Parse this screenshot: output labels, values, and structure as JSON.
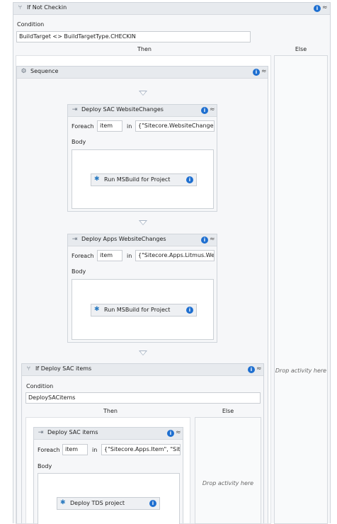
{
  "if_not_checkin": {
    "title": "If Not Checkin",
    "condition_label": "Condition",
    "condition_value": "BuildTarget <> BuildTargetType.CHECKIN",
    "then_label": "Then",
    "else_label": "Else",
    "else_drop": "Drop activity here"
  },
  "sequence": {
    "title": "Sequence"
  },
  "deploy_sac_changes": {
    "title": "Deploy SAC WebsiteChanges",
    "foreach_label": "Foreach",
    "item": "item",
    "in_label": "in",
    "collection": "{\"Sitecore.WebsiteChange",
    "body_label": "Body",
    "inner": "Run MSBuild for Project"
  },
  "deploy_apps_changes": {
    "title": "Deploy Apps WebsiteChanges",
    "foreach_label": "Foreach",
    "item": "item",
    "in_label": "in",
    "collection": "{\"Sitecore.Apps.Litmus.We",
    "body_label": "Body",
    "inner": "Run MSBuild for Project"
  },
  "if_deploy_sac": {
    "title": "If Deploy SAC items",
    "condition_label": "Condition",
    "condition_value": "DeploySACitems",
    "then_label": "Then",
    "else_label": "Else",
    "else_drop": "Drop activity here"
  },
  "deploy_sac_items": {
    "title": "Deploy SAC items",
    "foreach_label": "Foreach",
    "item": "item",
    "in_label": "in",
    "collection": "{\"Sitecore.Apps.Item\", \"Site",
    "body_label": "Body",
    "inner": "Deploy TDS project"
  },
  "icons": {
    "info": "i",
    "collapse": "≈",
    "if": "if-icon",
    "sequence": "sequence-icon",
    "foreach": "foreach-icon",
    "msbuild": "msbuild-icon"
  }
}
